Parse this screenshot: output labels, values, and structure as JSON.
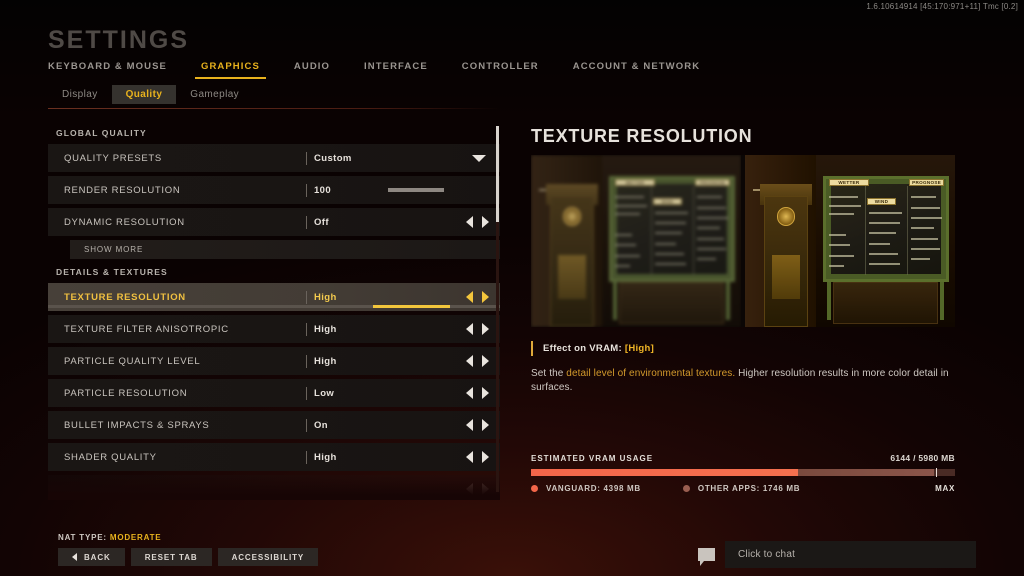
{
  "version_string": "1.6.10614914 [45:170:971+11] Tmc [0.2]",
  "header": {
    "title": "SETTINGS",
    "main_tabs": [
      {
        "label": "KEYBOARD & MOUSE",
        "active": false
      },
      {
        "label": "GRAPHICS",
        "active": true
      },
      {
        "label": "AUDIO",
        "active": false
      },
      {
        "label": "INTERFACE",
        "active": false
      },
      {
        "label": "CONTROLLER",
        "active": false
      },
      {
        "label": "ACCOUNT & NETWORK",
        "active": false
      }
    ],
    "sub_tabs": [
      {
        "label": "Display",
        "active": false
      },
      {
        "label": "Quality",
        "active": true
      },
      {
        "label": "Gameplay",
        "active": false
      }
    ]
  },
  "settings": {
    "groups": [
      {
        "header": "GLOBAL QUALITY",
        "rows": [
          {
            "label": "QUALITY PRESETS",
            "value": "Custom",
            "control": "dropdown"
          },
          {
            "label": "RENDER RESOLUTION",
            "value": "100",
            "control": "slider-mini"
          },
          {
            "label": "DYNAMIC RESOLUTION",
            "value": "Off",
            "control": "arrows"
          }
        ],
        "show_more_label": "SHOW MORE"
      },
      {
        "header": "DETAILS & TEXTURES",
        "rows": [
          {
            "label": "TEXTURE RESOLUTION",
            "value": "High",
            "control": "arrows-slider",
            "selected": true,
            "slider_percent": 72
          },
          {
            "label": "TEXTURE FILTER ANISOTROPIC",
            "value": "High",
            "control": "arrows"
          },
          {
            "label": "PARTICLE QUALITY LEVEL",
            "value": "High",
            "control": "arrows"
          },
          {
            "label": "PARTICLE RESOLUTION",
            "value": "Low",
            "control": "arrows"
          },
          {
            "label": "BULLET IMPACTS & SPRAYS",
            "value": "On",
            "control": "arrows"
          },
          {
            "label": "SHADER QUALITY",
            "value": "High",
            "control": "arrows"
          }
        ]
      }
    ]
  },
  "detail": {
    "title": "TEXTURE RESOLUTION",
    "preview_left_caption": "",
    "preview_right_caption": "",
    "vram_effect_prefix": "Effect on VRAM: ",
    "vram_effect_value": "[High]",
    "description_part1": "Set the ",
    "description_highlight": "detail level of environmental textures.",
    "description_part2": " Higher resolution results in more color detail in surfaces.",
    "scene_signs": {
      "sign_top_left": "WETTER",
      "sign_top_right": "PROGNOSE",
      "sign_middle": "WIND"
    }
  },
  "vram": {
    "label": "ESTIMATED VRAM USAGE",
    "amount": "6144 / 5980 MB",
    "legend": [
      {
        "name": "VANGUARD: 4398 MB",
        "color": "#f3664a"
      },
      {
        "name": "OTHER APPS: 1746 MB",
        "color": "#9a5e50"
      }
    ],
    "max_label": "MAX"
  },
  "footer": {
    "nat_label": "NAT TYPE: ",
    "nat_value": "MODERATE",
    "buttons": [
      {
        "label": "BACK",
        "has_back_icon": true
      },
      {
        "label": "RESET TAB",
        "has_back_icon": false
      },
      {
        "label": "ACCESSIBILITY",
        "has_back_icon": false
      }
    ]
  },
  "chat": {
    "placeholder": "Click to chat"
  }
}
